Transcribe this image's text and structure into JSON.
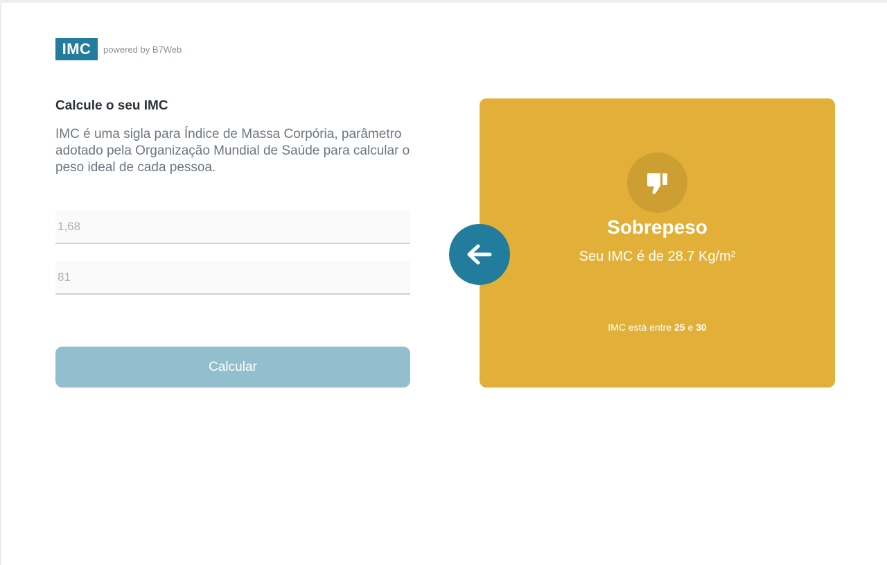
{
  "brand": {
    "logo": "IMC",
    "powered_by": "powered by B7Web"
  },
  "intro": {
    "heading": "Calcule o seu IMC",
    "description": "IMC é uma sigla para Índice de Massa Corpória, parâmetro adotado pela Organização Mundial de Saúde para calcular o peso ideal de cada pessoa."
  },
  "form": {
    "height_placeholder": "1,68",
    "weight_placeholder": "81",
    "calculate_label": "Calcular"
  },
  "result": {
    "icon": "thumbs-down-icon",
    "title": "Sobrepeso",
    "value_text": "Seu IMC é de 28.7 Kg/m²",
    "range_prefix": "IMC está entre",
    "range_min": "25",
    "range_joiner": "e",
    "range_max": "30",
    "color": "#e2b039"
  },
  "back_button": {
    "icon": "arrow-left-icon",
    "color": "#227c9d"
  }
}
